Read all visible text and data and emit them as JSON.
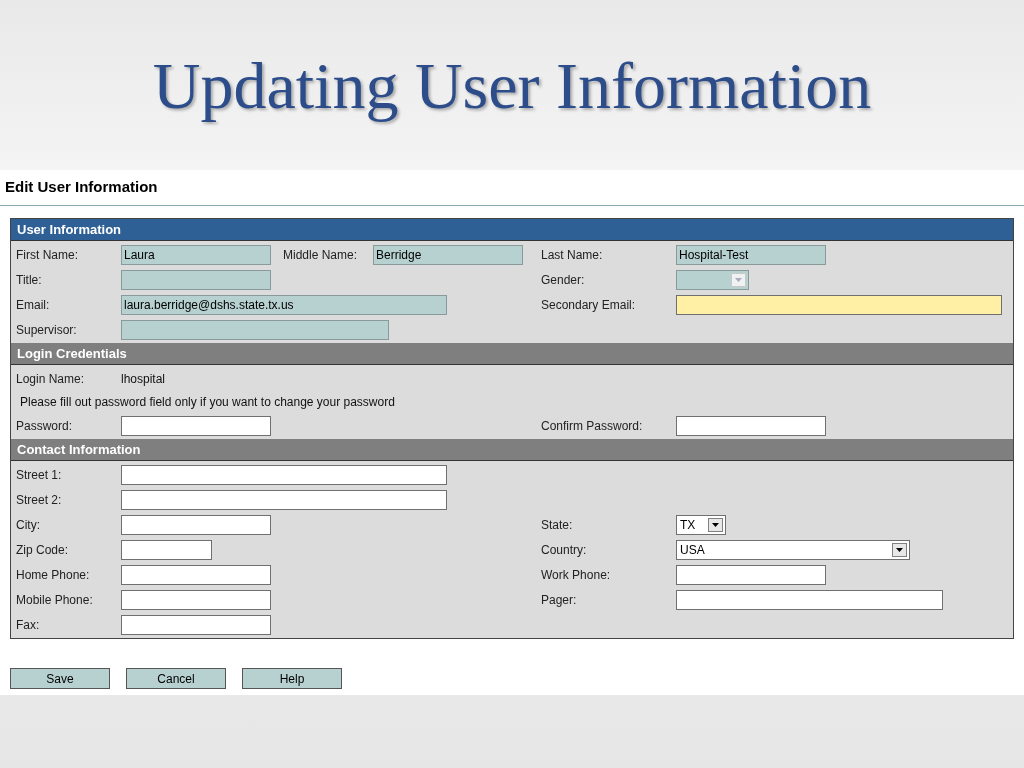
{
  "slide_title": "Updating User Information",
  "page_title": "Edit User Information",
  "sections": [
    {
      "title": "User Information",
      "color": "#2e6096",
      "rows": [
        {
          "left": {
            "label": "First Name:",
            "field": {
              "kind": "input",
              "value": "Laura",
              "disabled": true,
              "highlighted": false
            }
          },
          "middle": {
            "label": "Middle Name:",
            "field": {
              "kind": "input",
              "value": "Berridge",
              "disabled": true,
              "highlighted": false
            }
          },
          "right": {
            "label": "Last Name:",
            "field": {
              "kind": "input",
              "value": "Hospital-Test",
              "disabled": true,
              "highlighted": false
            }
          }
        },
        {
          "left": {
            "label": "Title:",
            "field": {
              "kind": "input",
              "disabled": true,
              "highlighted": false
            }
          },
          "right": {
            "label": "Gender:",
            "field": {
              "kind": "select",
              "disabled": true,
              "highlighted": false
            }
          }
        },
        {
          "left": {
            "label": "Email:",
            "field": {
              "kind": "input",
              "value": "laura.berridge@dshs.state.tx.us",
              "disabled": true,
              "highlighted": false
            }
          },
          "right": {
            "label": "Secondary Email:",
            "field": {
              "kind": "input",
              "disabled": false,
              "highlighted": true
            }
          }
        },
        {
          "left": {
            "label": "Supervisor:",
            "field": {
              "kind": "input",
              "disabled": true,
              "highlighted": false
            }
          }
        }
      ]
    },
    {
      "title": "Login Credentials",
      "color": "#7f7f7f",
      "rows": [
        {
          "left": {
            "label": "Login Name:",
            "field": {
              "kind": "static",
              "value": "lhospital"
            }
          }
        },
        {
          "note": "Please fill out password field only if you want to change your password"
        },
        {
          "left": {
            "label": "Password:",
            "field": {
              "kind": "input",
              "disabled": false,
              "highlighted": false
            }
          },
          "right": {
            "label": "Confirm Password:",
            "field": {
              "kind": "input",
              "disabled": false,
              "highlighted": false
            }
          }
        }
      ]
    },
    {
      "title": "Contact Information",
      "color": "#7f7f7f",
      "rows": [
        {
          "left": {
            "label": "Street 1:",
            "field": {
              "kind": "input",
              "disabled": false,
              "highlighted": false
            }
          }
        },
        {
          "left": {
            "label": "Street 2:",
            "field": {
              "kind": "input",
              "disabled": false,
              "highlighted": false
            }
          }
        },
        {
          "left": {
            "label": "City:",
            "field": {
              "kind": "input",
              "disabled": false,
              "highlighted": false
            }
          },
          "right": {
            "label": "State:",
            "field": {
              "kind": "select",
              "value": "TX",
              "disabled": false,
              "highlighted": false
            }
          }
        },
        {
          "left": {
            "label": "Zip Code:",
            "field": {
              "kind": "input",
              "disabled": false,
              "highlighted": false
            }
          },
          "right": {
            "label": "Country:",
            "field": {
              "kind": "select",
              "value": "USA",
              "disabled": false,
              "highlighted": false
            }
          }
        },
        {
          "left": {
            "label": "Home Phone:",
            "field": {
              "kind": "input",
              "disabled": false,
              "highlighted": false
            }
          },
          "right": {
            "label": "Work Phone:",
            "field": {
              "kind": "input",
              "disabled": false,
              "highlighted": false
            }
          }
        },
        {
          "left": {
            "label": "Mobile Phone:",
            "field": {
              "kind": "input",
              "disabled": false,
              "highlighted": false
            }
          },
          "right": {
            "label": "Pager:",
            "field": {
              "kind": "input",
              "disabled": false,
              "highlighted": false
            }
          }
        },
        {
          "left": {
            "label": "Fax:",
            "field": {
              "kind": "input",
              "disabled": false,
              "highlighted": false
            }
          }
        }
      ]
    }
  ],
  "buttons": [
    "Save",
    "Cancel",
    "Help"
  ]
}
